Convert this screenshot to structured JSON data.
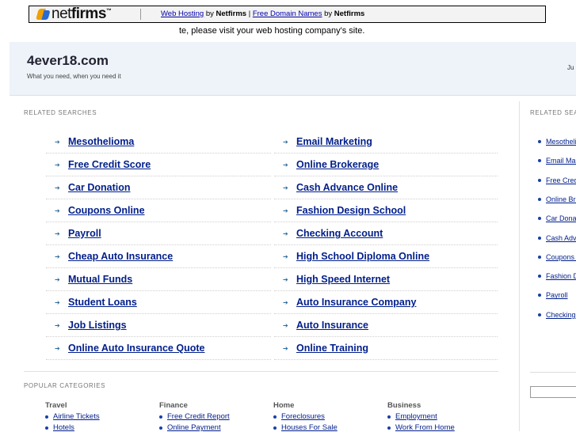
{
  "banner": {
    "logo_text_bold": "net",
    "logo_text_rest": "firms",
    "logo_tm": "™",
    "link1": "Web Hosting",
    "by1": " by ",
    "brand1": "Netfirms",
    "sep": " | ",
    "link2": "Free Domain Names",
    "by2": " by ",
    "brand2": "Netfirms"
  },
  "notice": "te, please visit your web hosting company's site.",
  "header": {
    "title": "4ever18.com",
    "tagline": "What you need, when you need it",
    "right_text": "Ju"
  },
  "related": {
    "label": "RELATED SEARCHES",
    "left": [
      "Mesothelioma",
      "Free Credit Score",
      "Car Donation",
      "Coupons Online",
      "Payroll",
      "Cheap Auto Insurance",
      "Mutual Funds",
      "Student Loans",
      "Job Listings",
      "Online Auto Insurance Quote"
    ],
    "right": [
      "Email Marketing",
      "Online Brokerage",
      "Cash Advance Online",
      "Fashion Design School",
      "Checking Account",
      "High School Diploma Online",
      "High Speed Internet",
      "Auto Insurance Company",
      "Auto Insurance",
      "Online Training"
    ]
  },
  "sidebar": {
    "label": "RELATED SEARCHES",
    "items": [
      "Mesothelioma",
      "Email Marketing",
      "Free Credit Score",
      "Online Brokerage",
      "Car Donation",
      "Cash Advance Online",
      "Coupons Online",
      "Fashion Design School",
      "Payroll",
      "Checking Account"
    ]
  },
  "popular": {
    "label": "POPULAR CATEGORIES",
    "columns": [
      {
        "title": "Travel",
        "links": [
          "Airline Tickets",
          "Hotels"
        ]
      },
      {
        "title": "Finance",
        "links": [
          "Free Credit Report",
          "Online Payment"
        ]
      },
      {
        "title": "Home",
        "links": [
          "Foreclosures",
          "Houses For Sale"
        ]
      },
      {
        "title": "Business",
        "links": [
          "Employment",
          "Work From Home"
        ]
      }
    ]
  },
  "colors": {
    "link": "#001e8a",
    "header_bg": "#edf3f8",
    "arrow": "#2b6a9a"
  }
}
